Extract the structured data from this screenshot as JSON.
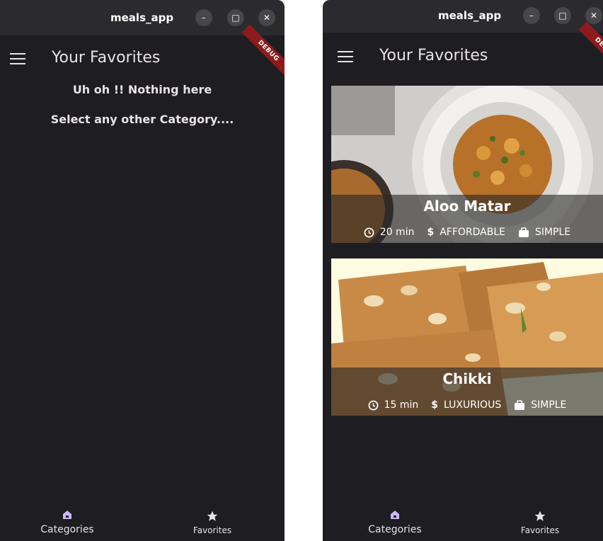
{
  "left_window": {
    "title": "meals_app",
    "window_controls": {
      "minimize": "–",
      "maximize": "□",
      "close": "✕"
    },
    "appbar": {
      "title": "Your Favorites",
      "menu_icon": "menu-icon"
    },
    "debug_banner": "DEBUG",
    "empty_message": "Uh oh !! Nothing here",
    "empty_hint": "Select any other Category....",
    "bottom_nav": {
      "items": [
        {
          "label": "Categories",
          "icon": "category-icon"
        },
        {
          "label": "Favorites",
          "icon": "star-icon"
        }
      ]
    }
  },
  "right_window": {
    "title": "meals_app",
    "window_controls": {
      "minimize": "–",
      "maximize": "□",
      "close": "✕"
    },
    "appbar": {
      "title": "Your Favorites",
      "menu_icon": "menu-icon"
    },
    "debug_banner": "DEBUG",
    "meals": [
      {
        "name": "Aloo Matar",
        "duration": "20 min",
        "affordability": "AFFORDABLE",
        "complexity": "SIMPLE"
      },
      {
        "name": "Chikki",
        "duration": "15 min",
        "affordability": "LUXURIOUS",
        "complexity": "SIMPLE"
      }
    ],
    "bottom_nav": {
      "items": [
        {
          "label": "Categories",
          "icon": "category-icon"
        },
        {
          "label": "Favorites",
          "icon": "star-icon"
        }
      ]
    }
  },
  "colors": {
    "background": "#1e1d22",
    "titlebar": "#2b2a2f",
    "text": "#e8e2ea",
    "debug_banner": "#8c1b1b",
    "category_icon": "#c9b8f5"
  }
}
